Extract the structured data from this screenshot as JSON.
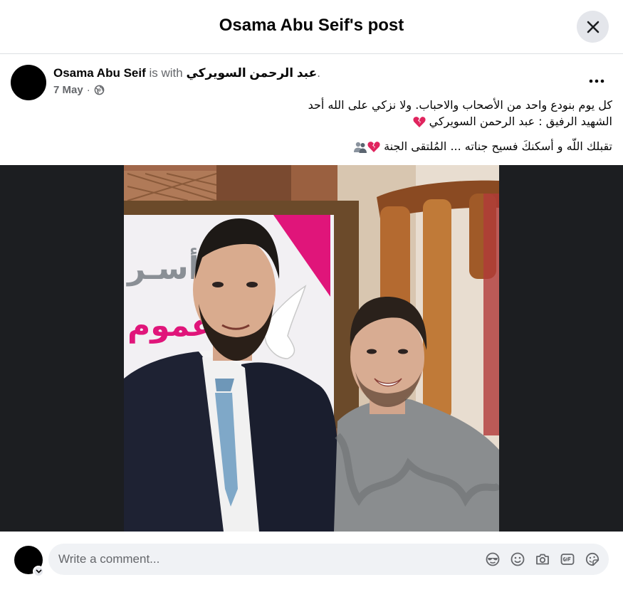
{
  "header": {
    "title": "Osama Abu Seif's post",
    "close_icon": "close-icon"
  },
  "post": {
    "author": "Osama Abu Seif",
    "with_text": " is with ",
    "tagged_person": "عبد الرحمن السويركي",
    "tagged_suffix": ".",
    "date": "7 May",
    "separator": "·",
    "privacy_icon": "globe-icon",
    "more_icon": "more-horizontal-icon",
    "text_line_1": "كل يوم بنودع واحد من الأصحاب والاحباب.  ولا نزكي على الله أحد",
    "text_line_2": "الشهيد الرفيق  :  عبد الرحمن السويركي",
    "text_line_3": "تقبلك اللّه و أسكنكَ فسيح جناته  ... المُلتقى الجنة",
    "emoji_line_2": "broken-heart-emoji",
    "emoji_line_3": [
      "broken-heart-emoji",
      "people-emoji"
    ],
    "photo_description": "photo-of-two-men"
  },
  "comment": {
    "placeholder": "Write a comment...",
    "icons": [
      "avatar-sticker-icon",
      "emoji-icon",
      "camera-icon",
      "gif-icon",
      "sticker-icon"
    ]
  },
  "colors": {
    "header_border": "#dddfe2",
    "close_bg": "#e4e6eb",
    "secondary_text": "#65676b",
    "photo_bg": "#1c1e21",
    "comment_bg": "#f0f2f5",
    "heart": "#e0245e"
  }
}
